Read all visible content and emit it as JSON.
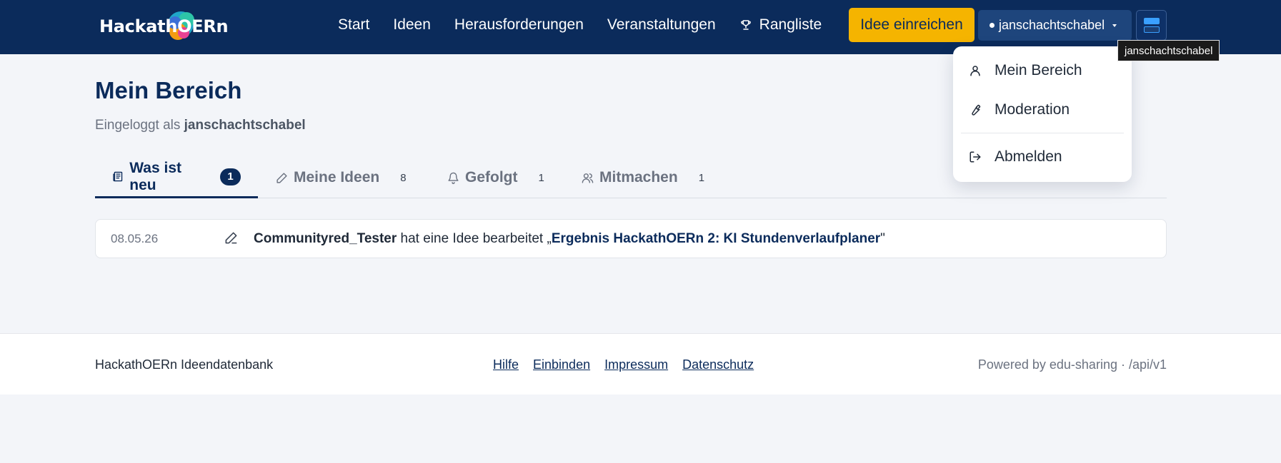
{
  "header": {
    "logo_text": "HackathOERn",
    "nav": [
      {
        "label": "Start"
      },
      {
        "label": "Ideen"
      },
      {
        "label": "Herausforderungen"
      },
      {
        "label": "Veranstaltungen"
      },
      {
        "label": "Rangliste",
        "icon": "trophy-icon"
      }
    ],
    "submit_label": "Idee einreichen",
    "user_label": "janschachtschabel",
    "tooltip": "janschachtschabel",
    "colors": {
      "bar": "#0b2b5b",
      "accent": "#f5b400"
    }
  },
  "user_menu": {
    "items": [
      {
        "label": "Mein Bereich",
        "icon": "user-icon"
      },
      {
        "label": "Moderation",
        "icon": "wrench-icon"
      },
      {
        "label": "Abmelden",
        "icon": "logout-icon"
      }
    ]
  },
  "main": {
    "title": "Mein Bereich",
    "logged_in_prefix": "Eingeloggt als",
    "logged_in_user": "janschachtschabel",
    "tabs": [
      {
        "label": "Was ist neu",
        "count": "1",
        "icon": "newspaper-icon",
        "active": true
      },
      {
        "label": "Meine Ideen",
        "count": "8",
        "icon": "pencil-icon"
      },
      {
        "label": "Gefolgt",
        "count": "1",
        "icon": "bell-icon"
      },
      {
        "label": "Mitmachen",
        "count": "1",
        "icon": "users-icon"
      }
    ],
    "activity": [
      {
        "date": "08.05.26",
        "actor": "Communityred_Tester",
        "action": "hat eine Idee bearbeitet",
        "idea_open": "„",
        "idea_title": "Ergebnis HackathOERn 2: KI Stundenverlaufplaner",
        "idea_close": "\""
      }
    ]
  },
  "footer": {
    "left": "HackathOERn Ideendatenbank",
    "links": [
      "Hilfe",
      "Einbinden",
      "Impressum",
      "Datenschutz"
    ],
    "right": "Powered by edu-sharing · /api/v1"
  }
}
